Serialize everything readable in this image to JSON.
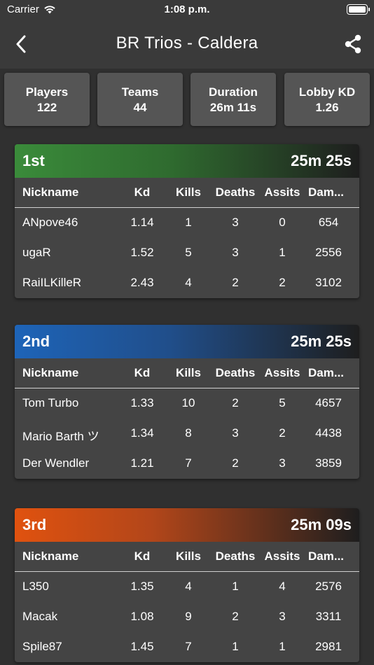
{
  "status_bar": {
    "carrier": "Carrier",
    "time": "1:08 p.m."
  },
  "nav": {
    "title": "BR Trios - Caldera",
    "back_icon": "chevron-left-icon",
    "share_icon": "share-icon"
  },
  "stats": [
    {
      "label": "Players",
      "value": "122"
    },
    {
      "label": "Teams",
      "value": "44"
    },
    {
      "label": "Duration",
      "value": "26m 11s"
    },
    {
      "label": "Lobby KD",
      "value": "1.26"
    }
  ],
  "columns": {
    "nickname": "Nickname",
    "kd": "Kd",
    "kills": "Kills",
    "deaths": "Deaths",
    "assists": "Assits",
    "damage": "Dam..."
  },
  "colors": {
    "first": "#3a8b3a",
    "second": "#1e64b8",
    "third": "#e0520f"
  },
  "teams": [
    {
      "place": "1st",
      "time": "25m 25s",
      "players": [
        {
          "nickname": "ANpove46",
          "kd": "1.14",
          "kills": "1",
          "deaths": "3",
          "assists": "0",
          "damage": "654"
        },
        {
          "nickname": "ugaR",
          "kd": "1.52",
          "kills": "5",
          "deaths": "3",
          "assists": "1",
          "damage": "2556"
        },
        {
          "nickname": "RaiILKilleR",
          "kd": "2.43",
          "kills": "4",
          "deaths": "2",
          "assists": "2",
          "damage": "3102"
        }
      ]
    },
    {
      "place": "2nd",
      "time": "25m 25s",
      "players": [
        {
          "nickname": "Tom Turbo",
          "kd": "1.33",
          "kills": "10",
          "deaths": "2",
          "assists": "5",
          "damage": "4657"
        },
        {
          "nickname": "Mario Barth ツ",
          "kd": "1.34",
          "kills": "8",
          "deaths": "3",
          "assists": "2",
          "damage": "4438"
        },
        {
          "nickname": "Der Wendler",
          "kd": "1.21",
          "kills": "7",
          "deaths": "2",
          "assists": "3",
          "damage": "3859"
        }
      ]
    },
    {
      "place": "3rd",
      "time": "25m 09s",
      "players": [
        {
          "nickname": "L350",
          "kd": "1.35",
          "kills": "4",
          "deaths": "1",
          "assists": "4",
          "damage": "2576"
        },
        {
          "nickname": "Macak",
          "kd": "1.08",
          "kills": "9",
          "deaths": "2",
          "assists": "3",
          "damage": "3311"
        },
        {
          "nickname": "Spile87",
          "kd": "1.45",
          "kills": "7",
          "deaths": "1",
          "assists": "1",
          "damage": "2981"
        }
      ]
    }
  ]
}
